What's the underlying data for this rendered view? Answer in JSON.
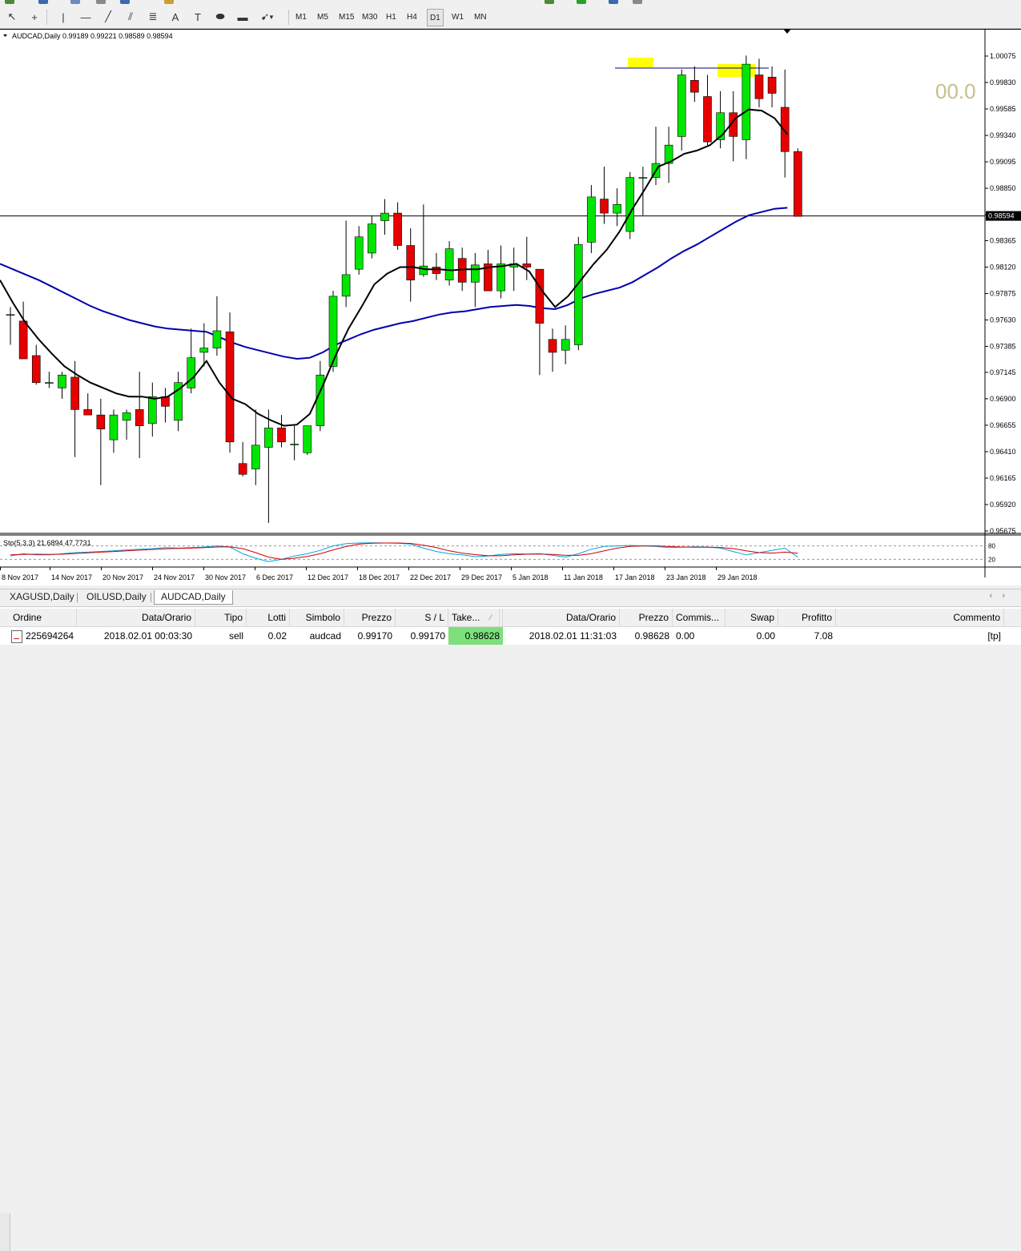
{
  "toolbar": {
    "tools": [
      {
        "name": "cursor-icon",
        "glyph": "↖"
      },
      {
        "name": "crosshair-icon",
        "glyph": "+"
      },
      {
        "name": "vertical-line-icon",
        "glyph": "|"
      },
      {
        "name": "horizontal-line-icon",
        "glyph": "—"
      },
      {
        "name": "trendline-icon",
        "glyph": "╱"
      },
      {
        "name": "equidistant-channel-icon",
        "glyph": "⫽"
      },
      {
        "name": "fibonacci-icon",
        "glyph": "≣"
      },
      {
        "name": "text-icon",
        "glyph": "A"
      },
      {
        "name": "text-label-icon",
        "glyph": "T"
      },
      {
        "name": "ellipse-icon",
        "glyph": "⬬"
      },
      {
        "name": "rectangle-icon",
        "glyph": "▬"
      },
      {
        "name": "arrow-shapes-icon",
        "glyph": "➹"
      }
    ],
    "timeframes": [
      "M1",
      "M5",
      "M15",
      "M30",
      "H1",
      "H4",
      "D1",
      "W1",
      "MN"
    ],
    "active_timeframe": "D1"
  },
  "chart": {
    "symbol_header": "AUDCAD,Daily  0.99189 0.99221 0.98589 0.98594",
    "overlay_label": "00.0",
    "current_price_label": "0.98594",
    "stochastic_label": "Sto(5,3,3) 21.6894 47.7731",
    "stoch_level_high": "80",
    "stoch_level_low": "20",
    "colors": {
      "bull": "#00e600",
      "bear": "#e60000",
      "ma_fast": "#000000",
      "ma_slow": "#0000b0",
      "sto_main": "#00a5e0",
      "sto_signal": "#d00000",
      "highlight": "#ffff00"
    }
  },
  "chart_data": {
    "type": "candlestick",
    "symbol": "AUDCAD",
    "timeframe": "Daily",
    "ylim": [
      0.95675,
      1.00075
    ],
    "y_ticks": [
      "1.00075",
      "0.99830",
      "0.99585",
      "0.99340",
      "0.99095",
      "0.98850",
      "0.98605",
      "0.98365",
      "0.98120",
      "0.97875",
      "0.97630",
      "0.97385",
      "0.97145",
      "0.96900",
      "0.96655",
      "0.96410",
      "0.96165",
      "0.95920",
      "0.95675"
    ],
    "x_ticks": [
      "8 Nov 2017",
      "14 Nov 2017",
      "20 Nov 2017",
      "24 Nov 2017",
      "30 Nov 2017",
      "6 Dec 2017",
      "12 Dec 2017",
      "18 Dec 2017",
      "22 Dec 2017",
      "29 Dec 2017",
      "5 Jan 2018",
      "11 Jan 2018",
      "17 Jan 2018",
      "23 Jan 2018",
      "29 Jan 2018"
    ],
    "candles": [
      {
        "o": 0.9768,
        "h": 0.9775,
        "l": 0.974,
        "c": 0.9768
      },
      {
        "o": 0.9762,
        "h": 0.978,
        "l": 0.973,
        "c": 0.9727
      },
      {
        "o": 0.973,
        "h": 0.974,
        "l": 0.9703,
        "c": 0.9705
      },
      {
        "o": 0.9705,
        "h": 0.9715,
        "l": 0.97,
        "c": 0.9705
      },
      {
        "o": 0.97,
        "h": 0.9715,
        "l": 0.969,
        "c": 0.9712
      },
      {
        "o": 0.971,
        "h": 0.9725,
        "l": 0.9636,
        "c": 0.968
      },
      {
        "o": 0.968,
        "h": 0.9695,
        "l": 0.9675,
        "c": 0.9675
      },
      {
        "o": 0.9675,
        "h": 0.969,
        "l": 0.961,
        "c": 0.9662
      },
      {
        "o": 0.9652,
        "h": 0.968,
        "l": 0.964,
        "c": 0.9675
      },
      {
        "o": 0.967,
        "h": 0.968,
        "l": 0.9652,
        "c": 0.9677
      },
      {
        "o": 0.968,
        "h": 0.9715,
        "l": 0.9635,
        "c": 0.9665
      },
      {
        "o": 0.9667,
        "h": 0.9705,
        "l": 0.9655,
        "c": 0.9692
      },
      {
        "o": 0.9692,
        "h": 0.97,
        "l": 0.9668,
        "c": 0.9683
      },
      {
        "o": 0.967,
        "h": 0.9715,
        "l": 0.966,
        "c": 0.9705
      },
      {
        "o": 0.97,
        "h": 0.9755,
        "l": 0.9695,
        "c": 0.9728
      },
      {
        "o": 0.9733,
        "h": 0.976,
        "l": 0.972,
        "c": 0.9737
      },
      {
        "o": 0.9737,
        "h": 0.9785,
        "l": 0.973,
        "c": 0.9753
      },
      {
        "o": 0.9752,
        "h": 0.977,
        "l": 0.964,
        "c": 0.965
      },
      {
        "o": 0.963,
        "h": 0.965,
        "l": 0.9618,
        "c": 0.962
      },
      {
        "o": 0.9625,
        "h": 0.968,
        "l": 0.961,
        "c": 0.9647
      },
      {
        "o": 0.9645,
        "h": 0.968,
        "l": 0.9575,
        "c": 0.9663
      },
      {
        "o": 0.9663,
        "h": 0.9675,
        "l": 0.9645,
        "c": 0.965
      },
      {
        "o": 0.9648,
        "h": 0.9665,
        "l": 0.9633,
        "c": 0.9648
      },
      {
        "o": 0.964,
        "h": 0.9665,
        "l": 0.9638,
        "c": 0.9665
      },
      {
        "o": 0.9665,
        "h": 0.9725,
        "l": 0.966,
        "c": 0.9712
      },
      {
        "o": 0.972,
        "h": 0.979,
        "l": 0.9715,
        "c": 0.9785
      },
      {
        "o": 0.9785,
        "h": 0.9855,
        "l": 0.9775,
        "c": 0.9805
      },
      {
        "o": 0.981,
        "h": 0.985,
        "l": 0.9805,
        "c": 0.984
      },
      {
        "o": 0.9825,
        "h": 0.986,
        "l": 0.982,
        "c": 0.9852
      },
      {
        "o": 0.9855,
        "h": 0.9875,
        "l": 0.9842,
        "c": 0.9862
      },
      {
        "o": 0.9862,
        "h": 0.9872,
        "l": 0.9828,
        "c": 0.9832
      },
      {
        "o": 0.9832,
        "h": 0.9848,
        "l": 0.978,
        "c": 0.98
      },
      {
        "o": 0.9805,
        "h": 0.987,
        "l": 0.9803,
        "c": 0.9813
      },
      {
        "o": 0.9812,
        "h": 0.9825,
        "l": 0.98,
        "c": 0.9806
      },
      {
        "o": 0.98,
        "h": 0.9836,
        "l": 0.9795,
        "c": 0.9829
      },
      {
        "o": 0.982,
        "h": 0.983,
        "l": 0.979,
        "c": 0.9798
      },
      {
        "o": 0.9798,
        "h": 0.9825,
        "l": 0.9775,
        "c": 0.9814
      },
      {
        "o": 0.9815,
        "h": 0.9828,
        "l": 0.9793,
        "c": 0.979
      },
      {
        "o": 0.979,
        "h": 0.9832,
        "l": 0.9783,
        "c": 0.9815
      },
      {
        "o": 0.9812,
        "h": 0.983,
        "l": 0.979,
        "c": 0.9815
      },
      {
        "o": 0.9815,
        "h": 0.984,
        "l": 0.98,
        "c": 0.9812
      },
      {
        "o": 0.981,
        "h": 0.981,
        "l": 0.9712,
        "c": 0.976
      },
      {
        "o": 0.9745,
        "h": 0.9755,
        "l": 0.9715,
        "c": 0.9733
      },
      {
        "o": 0.9735,
        "h": 0.9758,
        "l": 0.9722,
        "c": 0.9745
      },
      {
        "o": 0.974,
        "h": 0.984,
        "l": 0.9735,
        "c": 0.9833
      },
      {
        "o": 0.9835,
        "h": 0.9888,
        "l": 0.9825,
        "c": 0.9877
      },
      {
        "o": 0.9875,
        "h": 0.9905,
        "l": 0.9852,
        "c": 0.9862
      },
      {
        "o": 0.9862,
        "h": 0.9885,
        "l": 0.985,
        "c": 0.987
      },
      {
        "o": 0.9845,
        "h": 0.99,
        "l": 0.9838,
        "c": 0.9895
      },
      {
        "o": 0.9895,
        "h": 0.9905,
        "l": 0.986,
        "c": 0.9895
      },
      {
        "o": 0.9895,
        "h": 0.9942,
        "l": 0.9888,
        "c": 0.9908
      },
      {
        "o": 0.9908,
        "h": 0.9942,
        "l": 0.989,
        "c": 0.9925
      },
      {
        "o": 0.9933,
        "h": 0.9995,
        "l": 0.992,
        "c": 0.999
      },
      {
        "o": 0.9985,
        "h": 0.9998,
        "l": 0.9965,
        "c": 0.9974
      },
      {
        "o": 0.997,
        "h": 0.999,
        "l": 0.9925,
        "c": 0.9928
      },
      {
        "o": 0.993,
        "h": 0.9975,
        "l": 0.9922,
        "c": 0.9955
      },
      {
        "o": 0.9955,
        "h": 0.9975,
        "l": 0.991,
        "c": 0.9933
      },
      {
        "o": 0.993,
        "h": 1.0008,
        "l": 0.9912,
        "c": 1.0
      },
      {
        "o": 0.999,
        "h": 1.0005,
        "l": 0.996,
        "c": 0.9968
      },
      {
        "o": 0.9988,
        "h": 0.9998,
        "l": 0.996,
        "c": 0.9973
      },
      {
        "o": 0.996,
        "h": 0.9995,
        "l": 0.9895,
        "c": 0.9919
      },
      {
        "o": 0.9919,
        "h": 0.9922,
        "l": 0.9859,
        "c": 0.9859
      }
    ],
    "ma_fast": [
      0.98,
      0.9779,
      0.976,
      0.9745,
      0.9732,
      0.972,
      0.9712,
      0.9705,
      0.97,
      0.9695,
      0.9692,
      0.9692,
      0.969,
      0.9692,
      0.97,
      0.971,
      0.9725,
      0.9705,
      0.969,
      0.9685,
      0.9676,
      0.967,
      0.9665,
      0.9666,
      0.9676,
      0.9702,
      0.973,
      0.9755,
      0.9775,
      0.9796,
      0.9806,
      0.9812,
      0.9812,
      0.981,
      0.981,
      0.9809,
      0.981,
      0.981,
      0.9812,
      0.9813,
      0.9815,
      0.9808,
      0.979,
      0.9775,
      0.9785,
      0.98,
      0.9815,
      0.9828,
      0.9845,
      0.9866,
      0.9885,
      0.9905,
      0.991,
      0.9917,
      0.992,
      0.9925,
      0.9935,
      0.995,
      0.9958,
      0.9957,
      0.995,
      0.9935
    ],
    "ma_slow": [
      0.9815,
      0.981,
      0.9805,
      0.98,
      0.9794,
      0.9788,
      0.9782,
      0.9776,
      0.9771,
      0.9767,
      0.9763,
      0.976,
      0.9757,
      0.9755,
      0.9754,
      0.9753,
      0.9752,
      0.9747,
      0.9742,
      0.9738,
      0.9735,
      0.9732,
      0.9729,
      0.9727,
      0.9728,
      0.9733,
      0.974,
      0.9745,
      0.975,
      0.9754,
      0.9757,
      0.976,
      0.9762,
      0.9765,
      0.9768,
      0.977,
      0.9771,
      0.9773,
      0.9775,
      0.9776,
      0.9777,
      0.9776,
      0.9774,
      0.9773,
      0.9777,
      0.9783,
      0.9787,
      0.979,
      0.9793,
      0.9798,
      0.9805,
      0.9812,
      0.982,
      0.9827,
      0.9833,
      0.984,
      0.9847,
      0.9854,
      0.986,
      0.9863,
      0.9866,
      0.9867
    ],
    "stochastic": {
      "ylim": [
        0,
        100
      ],
      "levels": [
        20,
        80
      ],
      "main": [
        35,
        45,
        40,
        40,
        45,
        50,
        52,
        55,
        58,
        62,
        65,
        68,
        72,
        70,
        72,
        75,
        80,
        75,
        45,
        25,
        10,
        20,
        35,
        45,
        60,
        80,
        90,
        93,
        94,
        93,
        92,
        88,
        70,
        55,
        45,
        40,
        32,
        35,
        42,
        45,
        44,
        45,
        38,
        30,
        45,
        65,
        78,
        80,
        82,
        80,
        78,
        72,
        74,
        76,
        75,
        70,
        55,
        40,
        50,
        60,
        70,
        30
      ],
      "signal": [
        40,
        42,
        43,
        42,
        43,
        46,
        49,
        52,
        55,
        58,
        61,
        64,
        67,
        69,
        70,
        72,
        75,
        76,
        68,
        50,
        30,
        20,
        25,
        33,
        45,
        62,
        77,
        88,
        92,
        93,
        93,
        91,
        83,
        72,
        58,
        48,
        41,
        36,
        36,
        40,
        43,
        44,
        42,
        38,
        38,
        45,
        58,
        70,
        78,
        80,
        80,
        77,
        75,
        74,
        74,
        73,
        68,
        58,
        50,
        48,
        52,
        47
      ]
    }
  },
  "bottom_tabs": [
    "XAGUSD,Daily",
    "OILUSD,Daily",
    "AUDCAD,Daily"
  ],
  "active_tab": "AUDCAD,Daily",
  "terminal": {
    "headers": [
      "Ordine",
      "Data/Orario",
      "Tipo",
      "Lotti",
      "Simbolo",
      "Prezzo",
      "S / L",
      "Take...",
      "Data/Orario",
      "Prezzo",
      "Commis...",
      "Swap",
      "Profitto",
      "Commento"
    ],
    "rows": [
      [
        "225694264",
        "2018.02.01 00:03:30",
        "sell",
        "0.02",
        "audcad",
        "0.99170",
        "0.99170",
        "0.98628",
        "2018.02.01 11:31:03",
        "0.98628",
        "0.00",
        "0.00",
        "7.08",
        "[tp]"
      ]
    ]
  }
}
